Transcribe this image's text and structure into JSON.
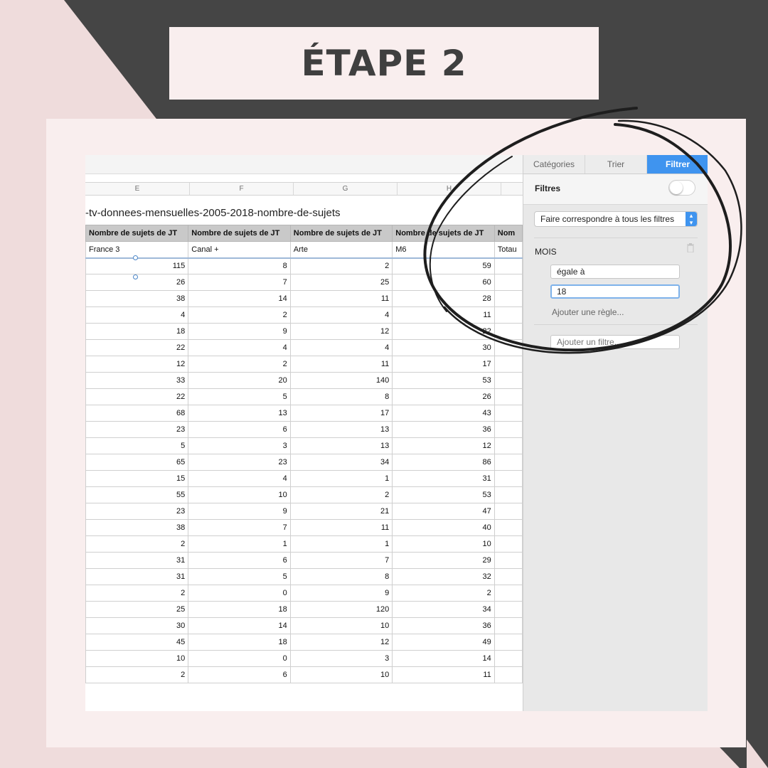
{
  "title": "ÉTAPE 2",
  "spreadsheet": {
    "column_letters": [
      "E",
      "F",
      "G",
      "H"
    ],
    "sheet_title": "-tv-donnees-mensuelles-2005-2018-nombre-de-sujets",
    "headers": [
      "Nombre de sujets de JT",
      "Nombre de sujets de JT",
      "Nombre de sujets de JT",
      "Nombre de sujets de JT",
      "Nom"
    ],
    "subheaders": [
      "France 3",
      "Canal +",
      "Arte",
      "M6",
      "Totau"
    ],
    "rows": [
      [
        115,
        8,
        2,
        59
      ],
      [
        26,
        7,
        25,
        60
      ],
      [
        38,
        14,
        11,
        28
      ],
      [
        4,
        2,
        4,
        11
      ],
      [
        18,
        9,
        12,
        22
      ],
      [
        22,
        4,
        4,
        30
      ],
      [
        12,
        2,
        11,
        17
      ],
      [
        33,
        20,
        140,
        53
      ],
      [
        22,
        5,
        8,
        26
      ],
      [
        68,
        13,
        17,
        43
      ],
      [
        23,
        6,
        13,
        36
      ],
      [
        5,
        3,
        13,
        12
      ],
      [
        65,
        23,
        34,
        86
      ],
      [
        15,
        4,
        1,
        31
      ],
      [
        55,
        10,
        2,
        53
      ],
      [
        23,
        9,
        21,
        47
      ],
      [
        38,
        7,
        11,
        40
      ],
      [
        2,
        1,
        1,
        10
      ],
      [
        31,
        6,
        7,
        29
      ],
      [
        31,
        5,
        8,
        32
      ],
      [
        2,
        0,
        9,
        2
      ],
      [
        25,
        18,
        120,
        34
      ],
      [
        30,
        14,
        10,
        36
      ],
      [
        45,
        18,
        12,
        49
      ],
      [
        10,
        0,
        3,
        14
      ],
      [
        2,
        6,
        10,
        11
      ]
    ]
  },
  "sidebar": {
    "tabs": [
      "Catégories",
      "Trier",
      "Filtrer"
    ],
    "active_tab": "Filtrer",
    "filters_label": "Filtres",
    "filters_toggle_on": false,
    "match_select": "Faire correspondre à tous les filtres",
    "column_name": "MOIS",
    "rule_condition": "égale à",
    "rule_value": "18",
    "add_rule": "Ajouter une règle...",
    "add_filter": "Ajouter un filtre..."
  },
  "colors": {
    "accent_blue": "#3f94ef",
    "dark_frame": "#454545",
    "pink_bg": "#efdcdc",
    "card_bg": "#f9eeee",
    "title_text": "#3f3f3f"
  }
}
